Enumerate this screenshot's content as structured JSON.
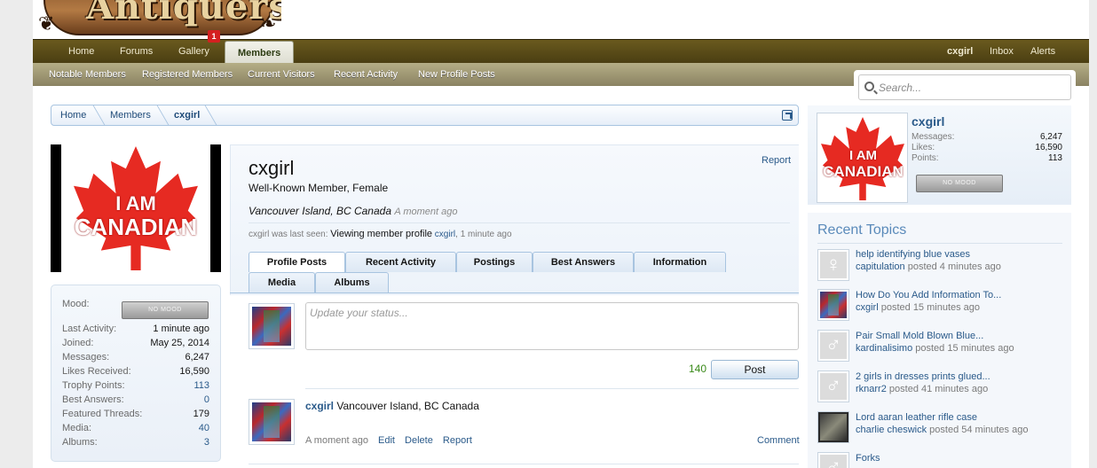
{
  "logo": {
    "text": "Antiquers"
  },
  "nav": {
    "tabs": [
      "Home",
      "Forums",
      "Gallery",
      "Members"
    ],
    "gallery_badge": "1",
    "right": [
      "cxgirl",
      "Inbox",
      "Alerts"
    ],
    "sub": [
      "Notable Members",
      "Registered Members",
      "Current Visitors",
      "Recent Activity",
      "New Profile Posts"
    ]
  },
  "search": {
    "placeholder": "Search..."
  },
  "breadcrumb": [
    "Home",
    "Members",
    "cxgirl"
  ],
  "avatar": {
    "line1": "I AM",
    "line2": "CANADIAN"
  },
  "stats": {
    "mood_label": "Mood:",
    "mood_button": "NO MOOD",
    "rows": [
      {
        "label": "Last Activity:",
        "value": "1 minute ago"
      },
      {
        "label": "Joined:",
        "value": "May 25, 2014"
      },
      {
        "label": "Messages:",
        "value": "6,247"
      },
      {
        "label": "Likes Received:",
        "value": "16,590"
      },
      {
        "label": "Trophy Points:",
        "value": "113"
      },
      {
        "label": "Best Answers:",
        "value": "0"
      },
      {
        "label": "Featured Threads:",
        "value": "179"
      },
      {
        "label": "Media:",
        "value": "40"
      },
      {
        "label": "Albums:",
        "value": "3"
      }
    ]
  },
  "profile": {
    "username": "cxgirl",
    "title": "Well-Known Member, Female",
    "report": "Report",
    "location": "Vancouver Island, BC Canada",
    "location_time": "A moment ago",
    "last_seen_prefix": "cxgirl was last seen:",
    "last_seen_action": "Viewing member profile",
    "last_seen_link": "cxgirl",
    "last_seen_time": ", 1 minute ago",
    "tabs": [
      "Profile Posts",
      "Recent Activity",
      "Postings",
      "Best Answers",
      "Information",
      "Media",
      "Albums"
    ],
    "status_placeholder": "Update your status...",
    "char_counter": "140",
    "post_button": "Post",
    "post": {
      "author": "cxgirl",
      "text": "Vancouver Island, BC Canada",
      "time": "A moment ago",
      "actions": [
        "Edit",
        "Delete",
        "Report"
      ],
      "comment": "Comment"
    }
  },
  "sidebar": {
    "username": "cxgirl",
    "stats": [
      {
        "label": "Messages:",
        "value": "6,247"
      },
      {
        "label": "Likes:",
        "value": "16,590"
      },
      {
        "label": "Points:",
        "value": "113"
      }
    ],
    "mood_button": "NO MOOD",
    "recent_topics_heading": "Recent Topics",
    "topics": [
      {
        "title": "help identifying blue vases",
        "user": "capitulation",
        "meta": "posted 4 minutes ago",
        "icon": "female-icon"
      },
      {
        "title": "How Do You Add Information To...",
        "user": "cxgirl",
        "meta": "posted 15 minutes ago",
        "icon": "user-avatar"
      },
      {
        "title": "Pair Small Mold Blown Blue...",
        "user": "kardinalisimo",
        "meta": "posted 15 minutes ago",
        "icon": "male-icon"
      },
      {
        "title": "2 girls in dresses prints glued...",
        "user": "rknarr2",
        "meta": "posted 41 minutes ago",
        "icon": "male-icon"
      },
      {
        "title": "Lord aaran leather rifle case",
        "user": "charlie cheswick",
        "meta": "posted 54 minutes ago",
        "icon": "user-avatar"
      },
      {
        "title": "Forks",
        "user": "",
        "meta": "",
        "icon": "male-icon"
      }
    ]
  }
}
